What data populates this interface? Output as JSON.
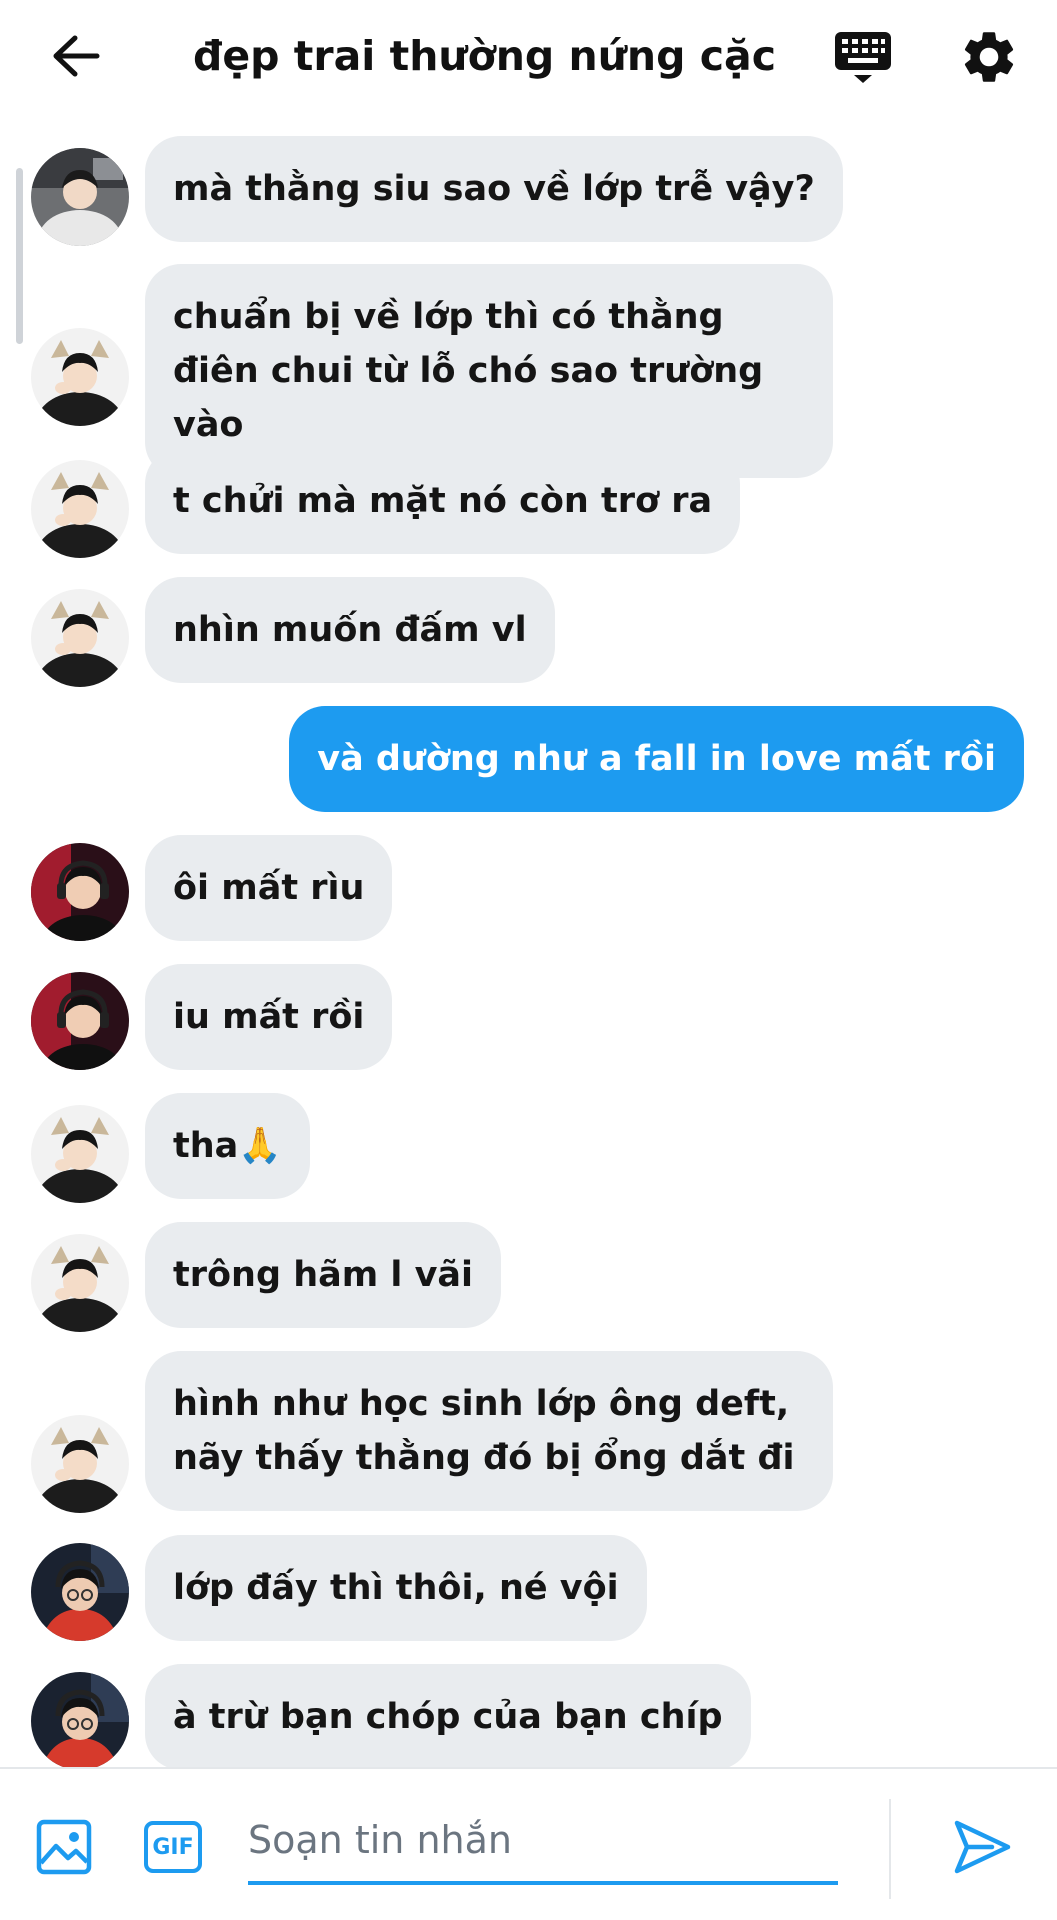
{
  "header": {
    "title": "đẹp trai thường nứng cặc",
    "back_icon": "arrow-left-icon",
    "keyboard_icon": "keyboard-icon",
    "settings_icon": "gear-icon"
  },
  "messages": [
    {
      "text": "mà thằng siu sao về lớp trễ vậy?",
      "direction": "in",
      "avatar": "photo-hoodie"
    },
    {
      "text": "chuẩn bị về lớp thì có thằng điên chui từ lỗ chó sao trường vào",
      "direction": "in",
      "avatar": "photo-cat-ears"
    },
    {
      "text": "t chửi mà mặt nó còn trơ ra",
      "direction": "in",
      "avatar": "photo-cat-ears"
    },
    {
      "text": "nhìn muốn đấm vl",
      "direction": "in",
      "avatar": "photo-cat-ears"
    },
    {
      "text": "và dường như a fall in love mất rồi",
      "direction": "out"
    },
    {
      "text": "ôi mất rìu",
      "direction": "in",
      "avatar": "photo-headset-red"
    },
    {
      "text": "iu mất rồi",
      "direction": "in",
      "avatar": "photo-headset-red"
    },
    {
      "text": "tha🙏",
      "direction": "in",
      "avatar": "photo-cat-ears"
    },
    {
      "text": "trông hãm l vãi",
      "direction": "in",
      "avatar": "photo-cat-ears"
    },
    {
      "text": "hình như học sinh lớp ông deft, nãy thấy thằng đó bị ổng dắt đi",
      "direction": "in",
      "avatar": "photo-cat-ears"
    },
    {
      "text": "lớp đấy thì thôi, né vội",
      "direction": "in",
      "avatar": "photo-glasses-headset"
    },
    {
      "text": "à trừ bạn chóp của bạn chíp",
      "direction": "in",
      "avatar": "photo-glasses-headset"
    }
  ],
  "composer": {
    "placeholder": "Soạn tin nhắn",
    "value": "",
    "gif_label": "GIF",
    "image_icon": "image-icon",
    "send_icon": "send-icon"
  },
  "colors": {
    "accent": "#1d9bf0",
    "bubble_in": "#e9ecef",
    "bubble_out": "#1d9bf0"
  }
}
